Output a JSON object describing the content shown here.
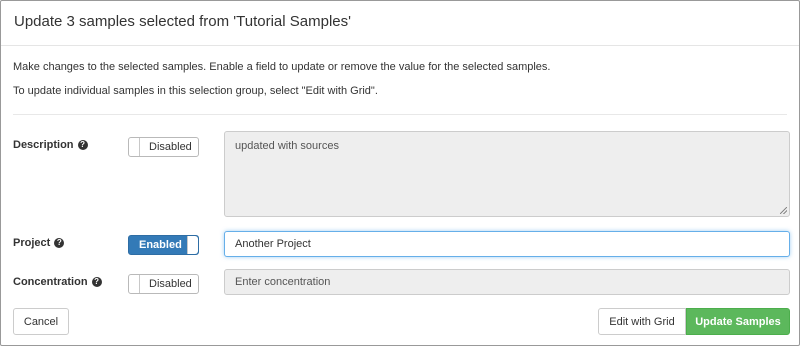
{
  "modal": {
    "title": "Update 3 samples selected from 'Tutorial Samples'",
    "intro_line1": "Make changes to the selected samples. Enable a field to update or remove the value for the selected samples.",
    "intro_line2": "To update individual samples in this selection group, select \"Edit with Grid\"."
  },
  "fields": {
    "description": {
      "label": "Description",
      "toggle_label": "Disabled",
      "enabled": false,
      "value": "updated with sources"
    },
    "project": {
      "label": "Project",
      "toggle_label": "Enabled",
      "enabled": true,
      "value": "Another Project"
    },
    "concentration": {
      "label": "Concentration",
      "toggle_label": "Disabled",
      "enabled": false,
      "value": "",
      "placeholder": "Enter concentration"
    }
  },
  "icons": {
    "help": "?"
  },
  "footer": {
    "cancel_label": "Cancel",
    "edit_grid_label": "Edit with Grid",
    "update_label": "Update Samples"
  },
  "colors": {
    "enabled_toggle": "#337ab7",
    "primary_button": "#5cb85c",
    "disabled_field": "#eeeeee",
    "focus_border": "#66afe9"
  }
}
